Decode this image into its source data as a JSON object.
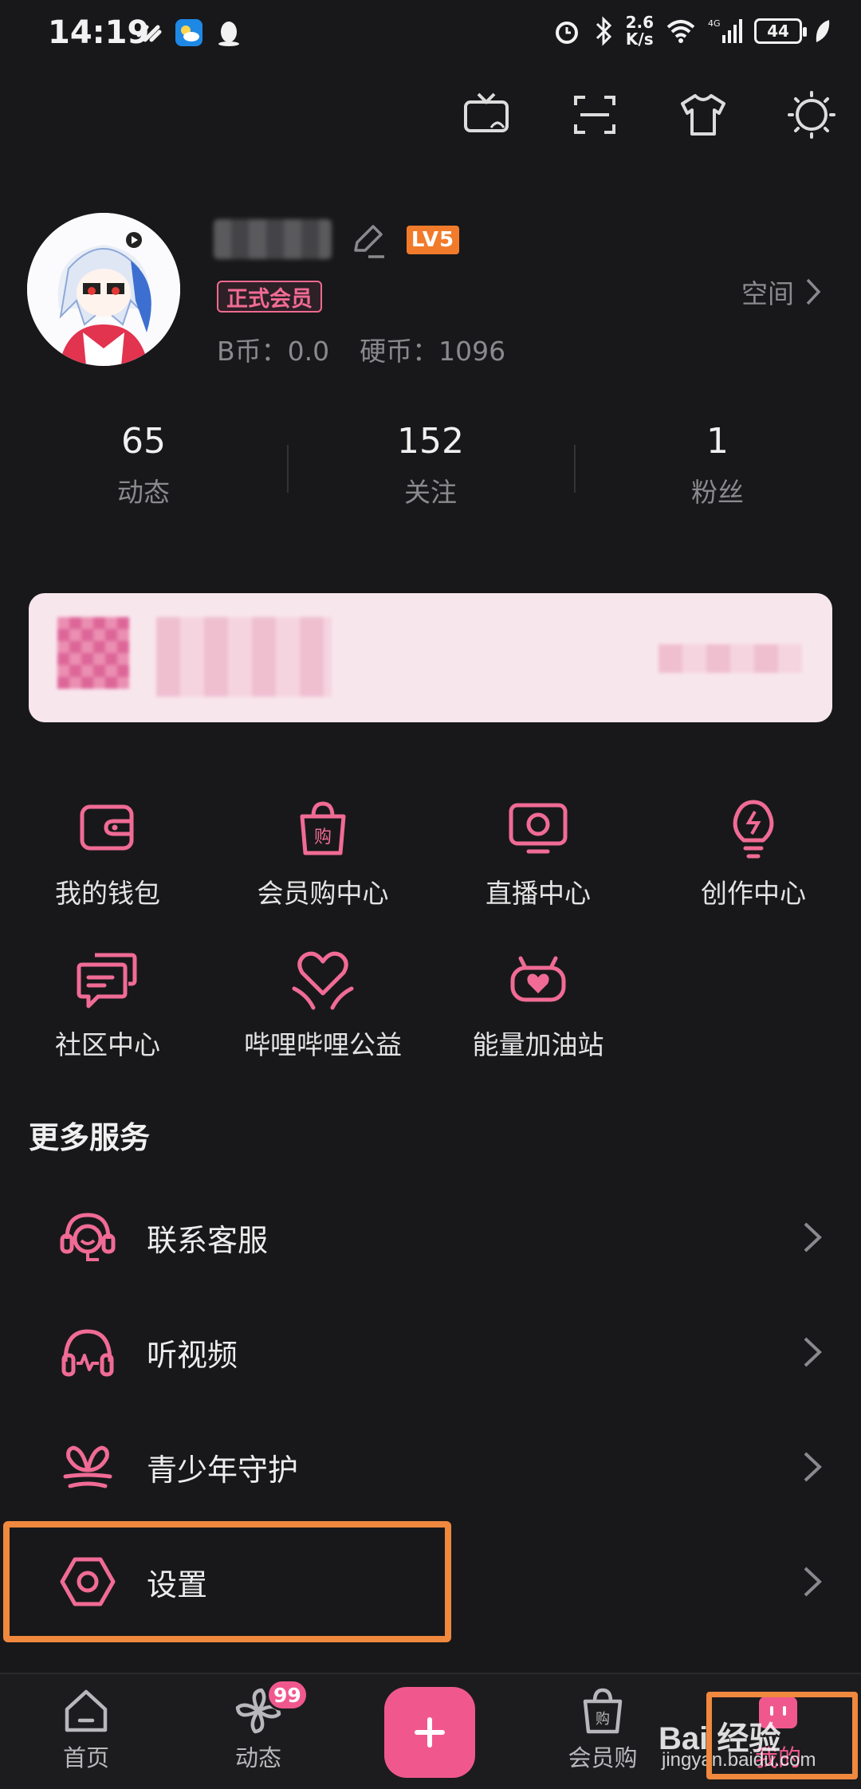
{
  "status_bar": {
    "time": "14:19",
    "net_speed_value": "2.6",
    "net_speed_unit": "K/s",
    "battery": "44"
  },
  "profile": {
    "level": "LV5",
    "vip_label": "正式会员",
    "b_coin": "B币：0.0",
    "coins": "硬币：1096",
    "space_link": "空间"
  },
  "stats": [
    {
      "value": "65",
      "label": "动态"
    },
    {
      "value": "152",
      "label": "关注"
    },
    {
      "value": "1",
      "label": "粉丝"
    }
  ],
  "services": [
    {
      "label": "我的钱包",
      "icon": "wallet-icon"
    },
    {
      "label": "会员购中心",
      "icon": "shopping-bag-icon"
    },
    {
      "label": "直播中心",
      "icon": "live-tv-icon"
    },
    {
      "label": "创作中心",
      "icon": "lightbulb-icon"
    },
    {
      "label": "社区中心",
      "icon": "chat-bubbles-icon"
    },
    {
      "label": "哔哩哔哩公益",
      "icon": "heart-hands-icon"
    },
    {
      "label": "能量加油站",
      "icon": "energy-heart-icon"
    }
  ],
  "more_services_title": "更多服务",
  "list": [
    {
      "label": "联系客服",
      "icon": "headset-icon"
    },
    {
      "label": "听视频",
      "icon": "headphones-icon"
    },
    {
      "label": "青少年守护",
      "icon": "sprout-icon"
    },
    {
      "label": "设置",
      "icon": "settings-hexagon-icon"
    }
  ],
  "bottom_nav": {
    "home": "首页",
    "dynamic": "动态",
    "dynamic_badge": "99",
    "shop": "会员购",
    "mine": "我的"
  },
  "watermark": {
    "brand": "Bai  经验",
    "url": "jingyan.baidu.com"
  },
  "colors": {
    "accent": "#f0588d",
    "background": "#18181a",
    "highlight": "#f0883e",
    "level_badge": "#f17b2a"
  }
}
